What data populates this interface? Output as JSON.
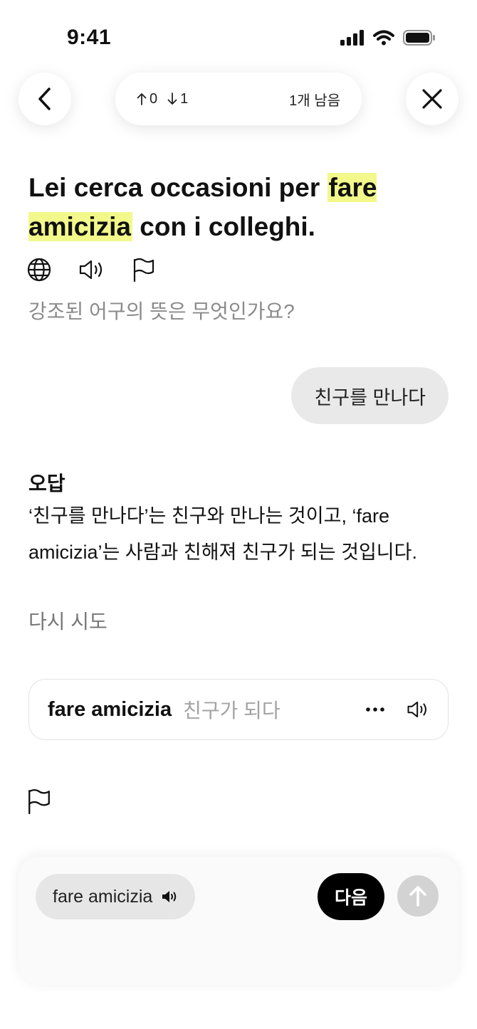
{
  "status_bar": {
    "time": "9:41"
  },
  "nav": {
    "upvotes": "0",
    "downvotes": "1",
    "remaining": "1개 남음"
  },
  "sentence": {
    "before": "Lei cerca occasioni per ",
    "highlight": "fare amicizia",
    "after": " con i colleghi."
  },
  "question": "강조된 어구의 뜻은 무엇인가요?",
  "answer": "친구를 만나다",
  "feedback": {
    "title": "오답",
    "explanation": "‘친구를 만나다’는 친구와 만나는 것이고, ‘fare amicizia’는 사람과 친해져 친구가 되는 것입니다.",
    "retry": "다시 시도"
  },
  "vocab": {
    "term": "fare amicizia",
    "meaning": "친구가 되다"
  },
  "bottom": {
    "chip": "fare amicizia",
    "next": "다음"
  },
  "colors": {
    "highlight": "#f2f98a",
    "next_button": "#000000",
    "send_button": "#d3d3d3"
  },
  "icons": [
    "back-icon",
    "close-icon",
    "arrow-up-icon",
    "arrow-down-icon",
    "globe-icon",
    "speaker-icon",
    "flag-icon",
    "more-icon",
    "send-icon",
    "signal-icon",
    "wifi-icon",
    "battery-icon"
  ]
}
